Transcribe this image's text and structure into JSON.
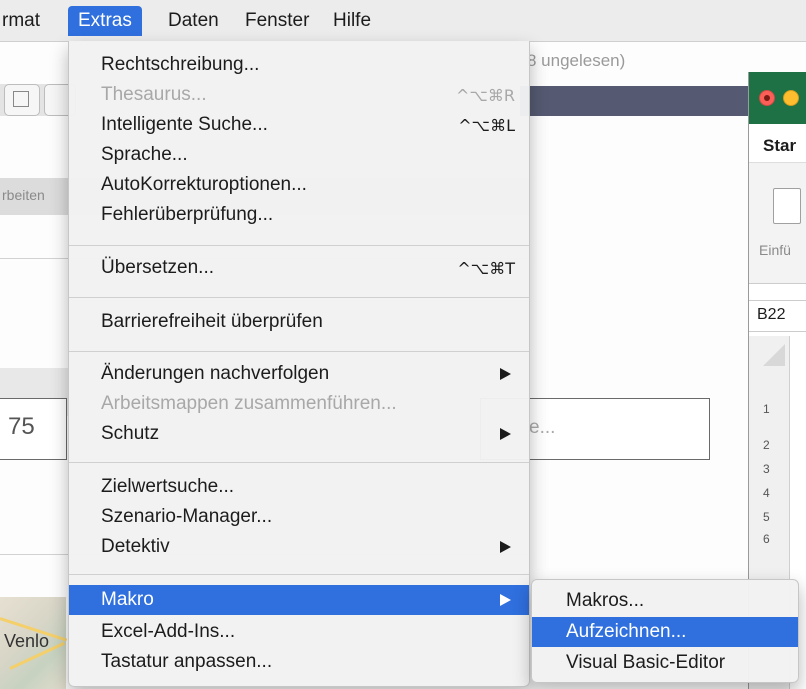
{
  "menubar": {
    "items": [
      {
        "label": "rmat",
        "active": false
      },
      {
        "label": "Extras",
        "active": true
      },
      {
        "label": "Daten",
        "active": false
      },
      {
        "label": "Fenster",
        "active": false
      },
      {
        "label": "Hilfe",
        "active": false
      }
    ],
    "accent_color": "#2f6fde"
  },
  "background": {
    "unread_text": "8 ungelesen)",
    "toolbar_label": "rbeiten",
    "field_value": "75",
    "field_placeholder_fragment": "e...",
    "map_label": "Venlo"
  },
  "excel": {
    "tab_label": "Star",
    "ribbon_label": "Einfü",
    "cell_ref": "B22",
    "row_numbers": [
      "1",
      "2",
      "3",
      "4",
      "5",
      "6"
    ]
  },
  "extras_menu": {
    "items": [
      {
        "label": "Rechtschreibung...",
        "shortcut": "",
        "disabled": false,
        "submenu": false
      },
      {
        "label": "Thesaurus...",
        "shortcut": "^⌥⌘R",
        "disabled": true,
        "submenu": false
      },
      {
        "label": "Intelligente Suche...",
        "shortcut": "^⌥⌘L",
        "disabled": false,
        "submenu": false
      },
      {
        "label": "Sprache...",
        "shortcut": "",
        "disabled": false,
        "submenu": false
      },
      {
        "label": "AutoKorrekturoptionen...",
        "shortcut": "",
        "disabled": false,
        "submenu": false
      },
      {
        "label": "Fehlerüberprüfung...",
        "shortcut": "",
        "disabled": false,
        "submenu": false
      },
      {
        "label": "Übersetzen...",
        "shortcut": "^⌥⌘T",
        "disabled": false,
        "submenu": false
      },
      {
        "label": "Barrierefreiheit überprüfen",
        "shortcut": "",
        "disabled": false,
        "submenu": false
      },
      {
        "label": "Änderungen nachverfolgen",
        "shortcut": "",
        "disabled": false,
        "submenu": true
      },
      {
        "label": "Arbeitsmappen zusammenführen...",
        "shortcut": "",
        "disabled": true,
        "submenu": false
      },
      {
        "label": "Schutz",
        "shortcut": "",
        "disabled": false,
        "submenu": true
      },
      {
        "label": "Zielwertsuche...",
        "shortcut": "",
        "disabled": false,
        "submenu": false
      },
      {
        "label": "Szenario-Manager...",
        "shortcut": "",
        "disabled": false,
        "submenu": false
      },
      {
        "label": "Detektiv",
        "shortcut": "",
        "disabled": false,
        "submenu": true
      },
      {
        "label": "Makro",
        "shortcut": "",
        "disabled": false,
        "submenu": true,
        "highlighted": true
      },
      {
        "label": "Excel-Add-Ins...",
        "shortcut": "",
        "disabled": false,
        "submenu": false
      },
      {
        "label": "Tastatur anpassen...",
        "shortcut": "",
        "disabled": false,
        "submenu": false
      }
    ]
  },
  "makro_submenu": {
    "items": [
      {
        "label": "Makros...",
        "highlighted": false
      },
      {
        "label": "Aufzeichnen...",
        "highlighted": true
      },
      {
        "label": "Visual Basic-Editor",
        "highlighted": false
      }
    ]
  }
}
